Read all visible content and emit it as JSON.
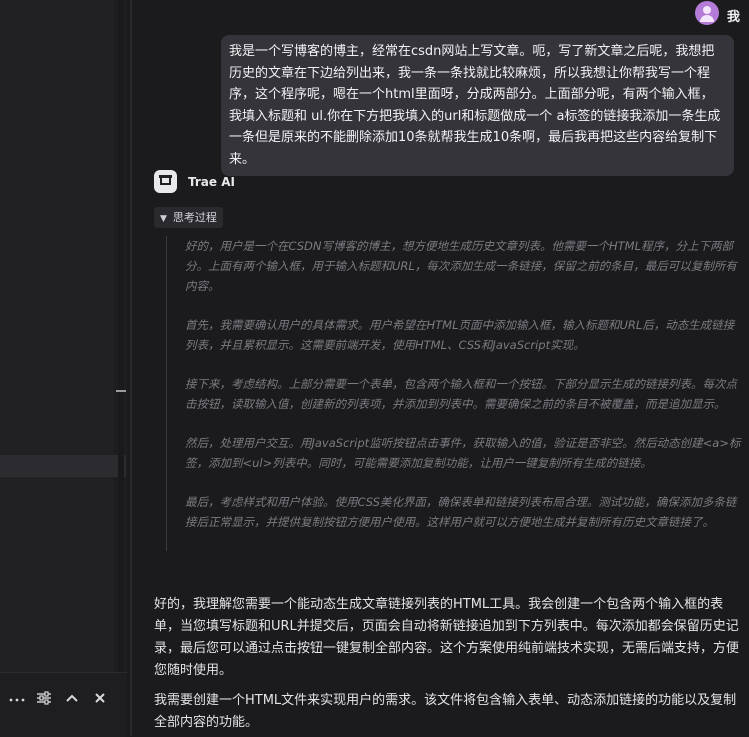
{
  "user": {
    "name": "我",
    "message": "我是一个写博客的博主，经常在csdn网站上写文章。呃，写了新文章之后呢，我想把历史的文章在下边给列出来，我一条一条找就比较麻烦，所以我想让你帮我写一个程序，这个程序呢，嗯在一个html里面呀，分成两部分。上面部分呢，有两个输入框，我填入标题和 ul.你在下方把我填入的url和标题做成一个 a标签的链接我添加一条生成一条但是原来的不能删除添加10条就帮我生成10条啊，最后我再把这些内容给复制下来。"
  },
  "assistant": {
    "name": "Trae AI",
    "thinking_label": "思考过程",
    "thinking": [
      "好的，用户是一个在CSDN写博客的博主，想方便地生成历史文章列表。他需要一个HTML程序，分上下两部分。上面有两个输入框，用于输入标题和URL，每次添加生成一条链接，保留之前的条目，最后可以复制所有内容。",
      "首先，我需要确认用户的具体需求。用户希望在HTML页面中添加输入框，输入标题和URL后，动态生成链接列表，并且累积显示。这需要前端开发，使用HTML、CSS和JavaScript实现。",
      "接下来，考虑结构。上部分需要一个表单，包含两个输入框和一个按钮。下部分显示生成的链接列表。每次点击按钮，读取输入值，创建新的列表项，并添加到列表中。需要确保之前的条目不被覆盖，而是追加显示。",
      "然后，处理用户交互。用JavaScript监听按钮点击事件，获取输入的值，验证是否非空。然后动态创建<a>标签，添加到<ul>列表中。同时，可能需要添加复制功能，让用户一键复制所有生成的链接。",
      "最后，考虑样式和用户体验。使用CSS美化界面，确保表单和链接列表布局合理。测试功能，确保添加多条链接后正常显示，并提供复制按钮方便用户使用。这样用户就可以方便地生成并复制所有历史文章链接了。"
    ],
    "answer": [
      "好的，我理解您需要一个能动态生成文章链接列表的HTML工具。我会创建一个包含两个输入框的表单，当您填写标题和URL并提交后，页面会自动将新链接追加到下方列表中。每次添加都会保留历史记录，最后您可以通过点击按钮一键复制全部内容。这个方案使用纯前端技术实现，无需后端支持，方便您随时使用。",
      "我需要创建一个HTML文件来实现用户的需求。该文件将包含输入表单、动态添加链接的功能以及复制全部内容的功能。"
    ]
  },
  "toolbar": {
    "icons": [
      "more-icon",
      "sliders-icon",
      "chevron-up-icon",
      "close-icon"
    ]
  }
}
